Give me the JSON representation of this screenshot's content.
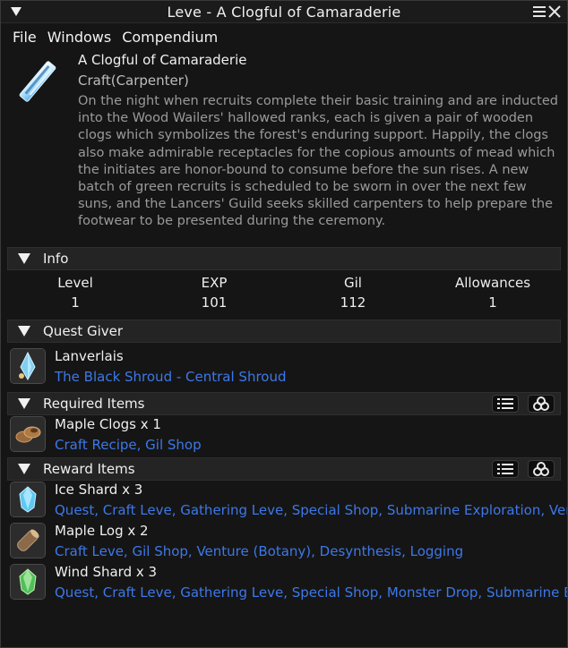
{
  "window": {
    "title": "Leve - A Clogful of Camaraderie"
  },
  "menubar": {
    "items": [
      "File",
      "Windows",
      "Compendium"
    ]
  },
  "leve": {
    "title": "A Clogful of Camaraderie",
    "type": "Craft(Carpenter)",
    "description": "On the night when recruits complete their basic training and are inducted into the Wood Wailers' hallowed ranks, each is given a pair of wooden clogs which symbolizes the forest's enduring support. Happily, the clogs also make admirable receptacles for the copious amounts of mead which the initiates are honor-bound to consume before the sun rises. A new batch of green recruits is scheduled to be sworn in over the next few suns, and the Lancers' Guild seeks skilled carpenters to help prepare the footwear to be presented during the ceremony."
  },
  "info": {
    "header": "Info",
    "columns": [
      {
        "label": "Level",
        "value": "1"
      },
      {
        "label": "EXP",
        "value": "101"
      },
      {
        "label": "Gil",
        "value": "112"
      },
      {
        "label": "Allowances",
        "value": "1"
      }
    ]
  },
  "quest_giver": {
    "header": "Quest Giver",
    "name": "Lanverlais",
    "location": "The Black Shroud - Central Shroud"
  },
  "required_items": {
    "header": "Required Items",
    "items": [
      {
        "name": "Maple Clogs x 1",
        "sources": "Craft Recipe, Gil Shop",
        "icon": "clogs-icon"
      }
    ]
  },
  "reward_items": {
    "header": "Reward Items",
    "items": [
      {
        "name": "Ice Shard x 3",
        "sources": "Quest, Craft Leve, Gathering Leve, Special Shop, Submarine Exploration, Venture",
        "icon": "ice-shard-icon"
      },
      {
        "name": "Maple Log x 2",
        "sources": "Craft Leve, Gil Shop, Venture (Botany), Desynthesis, Logging",
        "icon": "log-icon"
      },
      {
        "name": "Wind Shard x 3",
        "sources": "Quest, Craft Leve, Gathering Leve, Special Shop, Monster Drop, Submarine Explor",
        "icon": "wind-shard-icon"
      }
    ]
  },
  "colors": {
    "link": "#3d78e8",
    "background": "#151515",
    "header": "#242424"
  }
}
